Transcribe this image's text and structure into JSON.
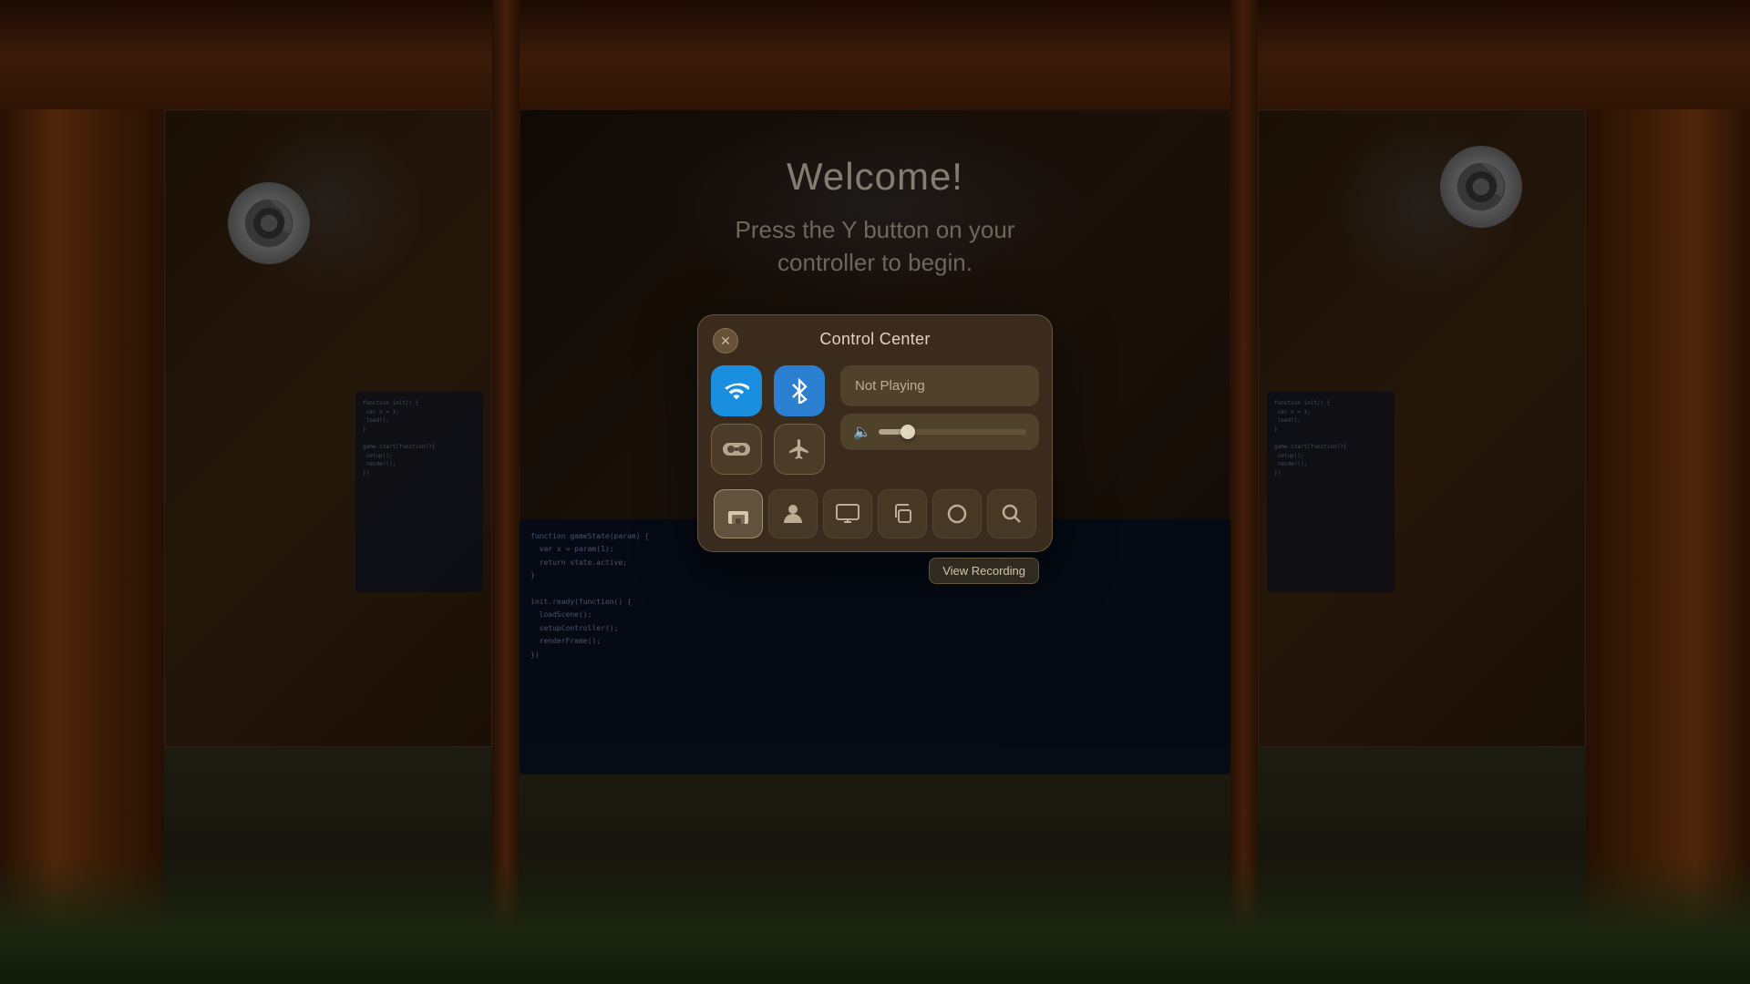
{
  "scene": {
    "background_desc": "VR room with wooden panels and code displays"
  },
  "welcome": {
    "title": "Welcome!",
    "subtitle_line1": "Press the Y button on your",
    "subtitle_line2": "controller to begin."
  },
  "control_center": {
    "title": "Control Center",
    "close_label": "✕",
    "wifi_icon": "wifi",
    "bluetooth_icon": "bluetooth",
    "vr_icon": "vr-headset",
    "airplane_icon": "airplane",
    "now_playing_label": "Not Playing",
    "volume_percent": 20,
    "toolbar_buttons": [
      {
        "id": "home",
        "icon": "🛏",
        "label": "Home",
        "active": true
      },
      {
        "id": "user",
        "icon": "👤",
        "label": "User",
        "active": false
      },
      {
        "id": "monitor",
        "icon": "🖥",
        "label": "Display",
        "active": false
      },
      {
        "id": "copy",
        "icon": "⧉",
        "label": "Copy",
        "active": false
      },
      {
        "id": "circle",
        "icon": "○",
        "label": "Circle",
        "active": false
      },
      {
        "id": "search",
        "icon": "🔍",
        "label": "Search",
        "active": false
      }
    ],
    "view_recording_label": "View Recording"
  },
  "code_lines": [
    "function gameState() {",
    "  var x = param(1);",
    "  return state;",
    "}",
    "",
    "init.ready(function() {",
    "  loadScene();",
    "  setup();",
    "})"
  ]
}
